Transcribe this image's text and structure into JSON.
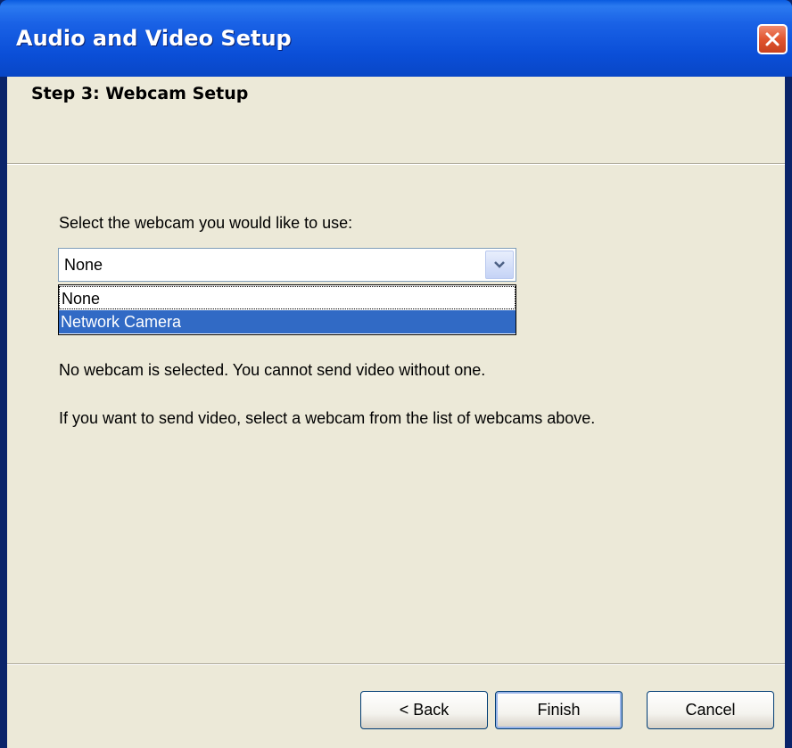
{
  "window": {
    "title": "Audio and Video Setup"
  },
  "header": {
    "step_title": "Step 3: Webcam Setup"
  },
  "main": {
    "prompt": "Select the webcam you would like to use:",
    "webcam_select": {
      "value": "None",
      "options": [
        "None",
        "Network Camera"
      ],
      "highlighted_option": "Network Camera"
    },
    "status_message": "No webcam is selected. You cannot send video without one.",
    "hint_message": "If you want to send video, select a webcam from the list of webcams above."
  },
  "footer": {
    "back_label": "< Back",
    "finish_label": "Finish",
    "cancel_label": "Cancel"
  },
  "icons": {
    "close": "close-icon",
    "dropdown": "chevron-down-icon"
  },
  "colors": {
    "title_bar": "#0a5be0",
    "selection": "#316ac5",
    "dialog_bg": "#ece9d8",
    "close_button": "#e1552f"
  }
}
